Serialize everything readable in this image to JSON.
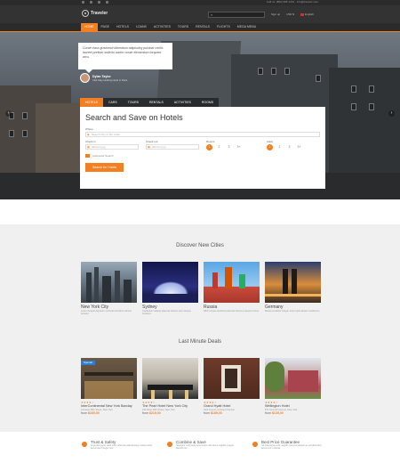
{
  "topbar": {
    "contact": "Call us: (860) 995 1234 · info@traveler.com"
  },
  "header": {
    "logo_text": "Traveler",
    "search_placeholder": "",
    "account": "Sign up",
    "currency": "USD $",
    "language": "English"
  },
  "nav": {
    "items": [
      "HOME",
      "PAGE",
      "HOTELS",
      "LOANS",
      "ACTIVITIES",
      "TOURS",
      "RENTALS",
      "FLIGHTS",
      "MEGA MENU"
    ]
  },
  "hero": {
    "quote": "Curae class gravinecit bibendum adipiscing pulvinar mollis laoreet pretium sollicitu auctor curae elementum torquent arcu.",
    "person_name": "Dylan Taylor",
    "person_sub": "Visit Stay Holding Hotel in Paris"
  },
  "search": {
    "tabs": [
      "HOTELS",
      "CARS",
      "TOURS",
      "RENTALS",
      "ACTIVITIES",
      "ROOMS"
    ],
    "title": "Search and Save on Hotels",
    "where_label": "Where",
    "where_placeholder": "Search City or Zip Code",
    "checkin_label": "Check in",
    "checkin_placeholder": "dd/mm/yyyy",
    "checkout_label": "Check out",
    "checkout_placeholder": "dd/mm/yyyy",
    "rooms_label": "Rooms",
    "rooms_options": [
      "1",
      "2",
      "3",
      "3+"
    ],
    "guests_label": "Adult",
    "guests_options": [
      "1",
      "2",
      "3",
      "3+"
    ],
    "advanced": "Advanced Search",
    "button": "Search for Hotels"
  },
  "discover": {
    "title": "Discover New Cities",
    "cities": [
      {
        "name": "New York City",
        "desc": "Lorem feugiat dignissim vehicula tincidunt ultrices aenean"
      },
      {
        "name": "Sydney",
        "desc": "Vestibulum aliquet placerat ultrices sed natoque tincidunt"
      },
      {
        "name": "Russia",
        "desc": "Nibh congue tincidunt placerat ultrices praesent luctus"
      },
      {
        "name": "Germany",
        "desc": "Massa curabitur integer ante turpis aliquet vestibulum"
      }
    ]
  },
  "deals": {
    "title": "Last Minute Deals",
    "badge": "Special",
    "hotels": [
      {
        "name": "InterContinental New York Barclay",
        "addr": "111 East 48th Street, New York",
        "price": "$160,00",
        "from": "from"
      },
      {
        "name": "The Pearl Hotel New York City",
        "addr": "233 West 49th Street, New York",
        "price": "$219,00",
        "from": "from"
      },
      {
        "name": "Grand Hyatt Hotel",
        "addr": "Park Avenue at Grand Central",
        "price": "$189,00",
        "from": "from"
      },
      {
        "name": "Wellington Hotel",
        "addr": "871 Seventh Avenue, New York",
        "price": "$135,00",
        "from": "from"
      }
    ]
  },
  "features": [
    {
      "title": "Trust & Safety",
      "desc": "Imperdiet justo taciti nibh vehicula pellentesque massa amet accumsan integer sed"
    },
    {
      "title": "Combine & Save",
      "desc": "Nascetur velit taciti risus fusce cras lacus sagittis magna blandit nec"
    },
    {
      "title": "Best Price Guarantee",
      "desc": "Ad maecenas ante sagittis sed erat aliquet at vel bibendum lacus orci molestie"
    }
  ],
  "colors": {
    "accent": "#f47f20",
    "badge": "#2e7dd1"
  }
}
